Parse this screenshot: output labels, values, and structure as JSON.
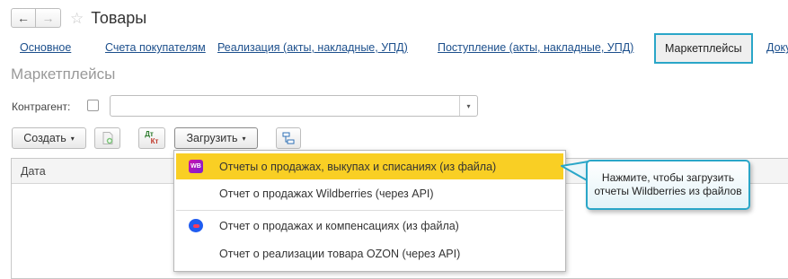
{
  "window": {
    "title": "Товары",
    "back_icon": "←",
    "forward_icon": "→",
    "favorite_icon": "☆"
  },
  "tabs": [
    {
      "label": "Основное",
      "active": false
    },
    {
      "label": "Счета покупателям",
      "active": false
    },
    {
      "label": "Реализация (акты, накладные, УПД)",
      "active": false
    },
    {
      "label": "Поступление (акты, накладные, УПД)",
      "active": false
    },
    {
      "label": "Маркетплейсы",
      "active": true
    },
    {
      "label": "Доку",
      "active": false
    }
  ],
  "section_title": "Маркетплейсы",
  "filter": {
    "label": "Контрагент:",
    "value": "",
    "dropdown_icon": "▾"
  },
  "toolbar": {
    "create_label": "Создать",
    "load_label": "Загрузить",
    "dtkt_top": "Дт",
    "dtkt_bottom": "Кт",
    "caret": "▾"
  },
  "grid": {
    "columns": [
      "Дата"
    ]
  },
  "load_menu": {
    "items": [
      {
        "label": "Отчеты о продажах, выкупах и списаниях (из файла)",
        "icon": "wb-icon",
        "icon_text": "WB",
        "highlighted": true
      },
      {
        "label": "Отчет о продажах Wildberries (через API)",
        "icon": "",
        "highlighted": false
      },
      {
        "label": "Отчет о продажах и компенсациях (из файла)",
        "icon": "ozon-icon",
        "highlighted": false
      },
      {
        "label": "Отчет о реализации товара OZON (через API)",
        "icon": "",
        "highlighted": false
      }
    ]
  },
  "tooltip": {
    "text": "Нажмите, чтобы загрузить отчеты Wildberries из файлов"
  },
  "colors": {
    "accent": "#2aa6c8",
    "highlight": "#f9cf24",
    "link": "#1c4f8c"
  }
}
